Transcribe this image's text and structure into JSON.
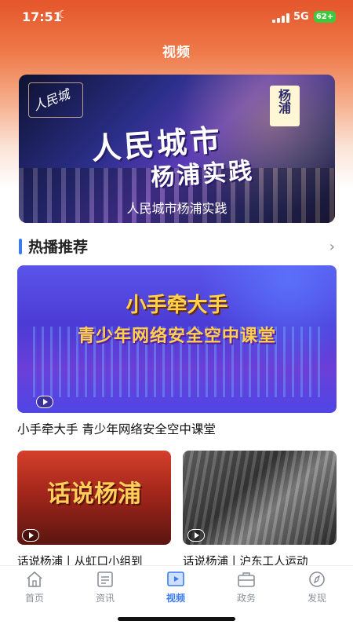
{
  "status_bar": {
    "time": "17:51",
    "network": "5G",
    "battery": "62+"
  },
  "page": {
    "title": "视频"
  },
  "hero": {
    "logo_text": "人民城",
    "title_line1": "人民城市",
    "title_line2": "杨浦实践",
    "seal_text": "杨浦",
    "caption": "人民城市杨浦实践"
  },
  "section": {
    "title": "热播推荐"
  },
  "feature": {
    "line1": "小手牵大手",
    "line2": "青少年网络安全空中课堂",
    "caption": "小手牵大手 青少年网络安全空中课堂"
  },
  "cards": [
    {
      "art_text": "话说杨浦",
      "caption": "话说杨浦丨从虹口小组到"
    },
    {
      "caption": "话说杨浦丨沪东工人运动"
    }
  ],
  "tabbar": {
    "items": [
      {
        "label": "首页",
        "icon": "home-icon"
      },
      {
        "label": "资讯",
        "icon": "news-icon"
      },
      {
        "label": "视频",
        "icon": "video-icon",
        "active": true
      },
      {
        "label": "政务",
        "icon": "briefcase-icon"
      },
      {
        "label": "发现",
        "icon": "compass-icon"
      }
    ]
  },
  "colors": {
    "accent": "#3a7bf2",
    "header_top": "#e4552a"
  }
}
